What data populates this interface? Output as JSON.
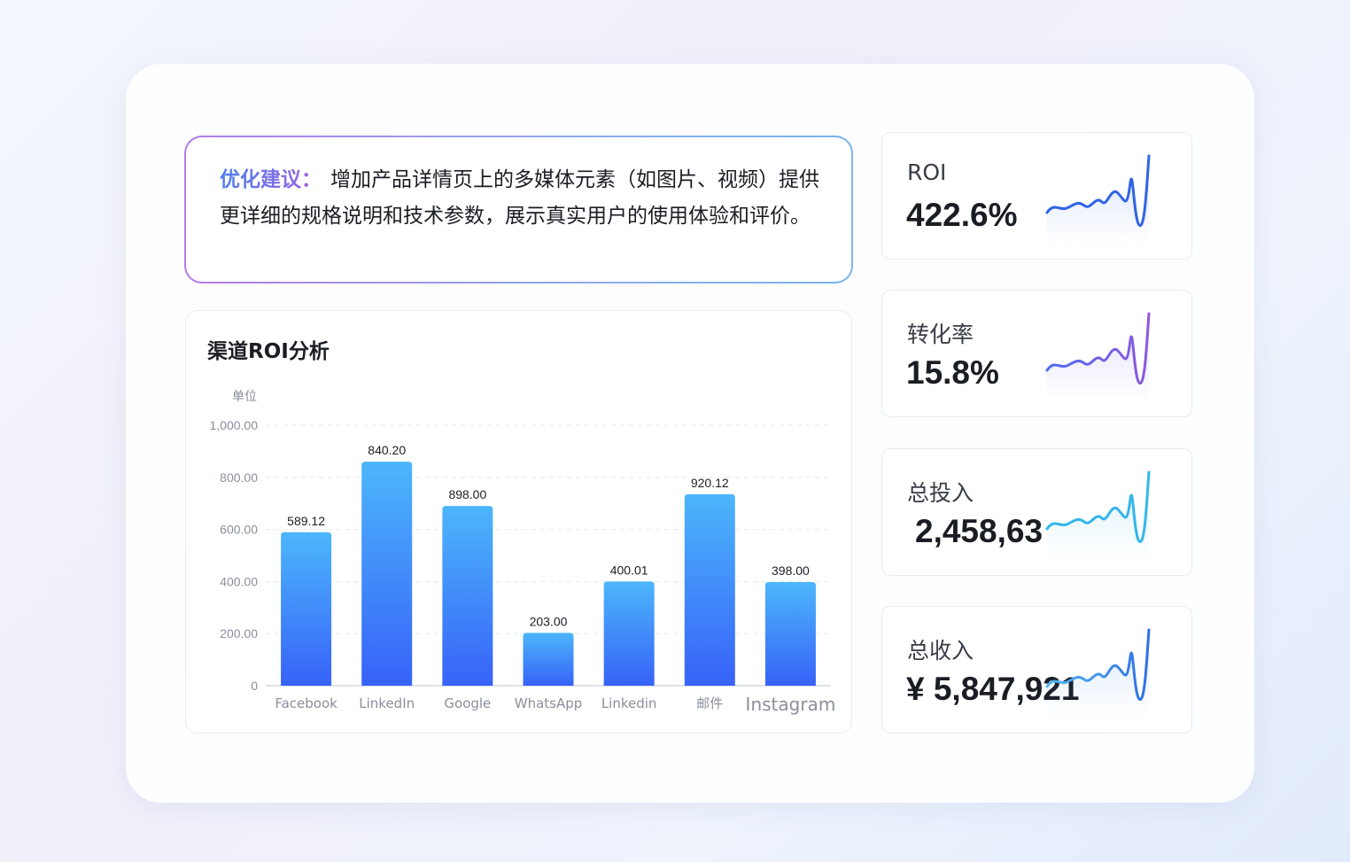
{
  "suggestion": {
    "label": "优化建议：",
    "text": "增加产品详情页上的多媒体元素（如图片、视频）提供更详细的规格说明和技术参数，展示真实用户的使用体验和评价。"
  },
  "chart_title": "渠道ROI分析",
  "chart_data": {
    "type": "bar",
    "unit_label": "单位",
    "categories": [
      "Facebook",
      "LinkedIn",
      "Google",
      "WhatsApp",
      "Linkedin",
      "邮件",
      "Instagram"
    ],
    "values": [
      589.12,
      860,
      690,
      203,
      400.01,
      735,
      398
    ],
    "data_labels": [
      "589.12",
      "840.20",
      "898.00",
      "203.00",
      "400.01",
      "920.12",
      "398.00"
    ],
    "y_ticks": [
      "0",
      "200.00",
      "400.00",
      "600.00",
      "800.00",
      "1,000.00"
    ],
    "ylim": [
      0,
      1000
    ],
    "grid": true,
    "bar_gradient": [
      "#4cb6fb",
      "#3762f8"
    ]
  },
  "kpis": [
    {
      "label": "ROI",
      "value": "422.6%",
      "color": "#2f64e6",
      "gradient": [
        "#2f64e6",
        "#2f64e6"
      ]
    },
    {
      "label": "转化率",
      "value": "15.8%",
      "color": "#6a5ee8",
      "gradient": [
        "#4f6cf0",
        "#8e58e0"
      ]
    },
    {
      "label": "总投入",
      "value": "2,458,63",
      "color": "#35b6ec",
      "gradient": [
        "#35b6ec",
        "#35b6ec"
      ]
    },
    {
      "label": "总收入",
      "value": "¥ 5,847,921",
      "color": "#3d86ea",
      "gradient": [
        "#55b7ef",
        "#2f6fe6"
      ]
    }
  ]
}
